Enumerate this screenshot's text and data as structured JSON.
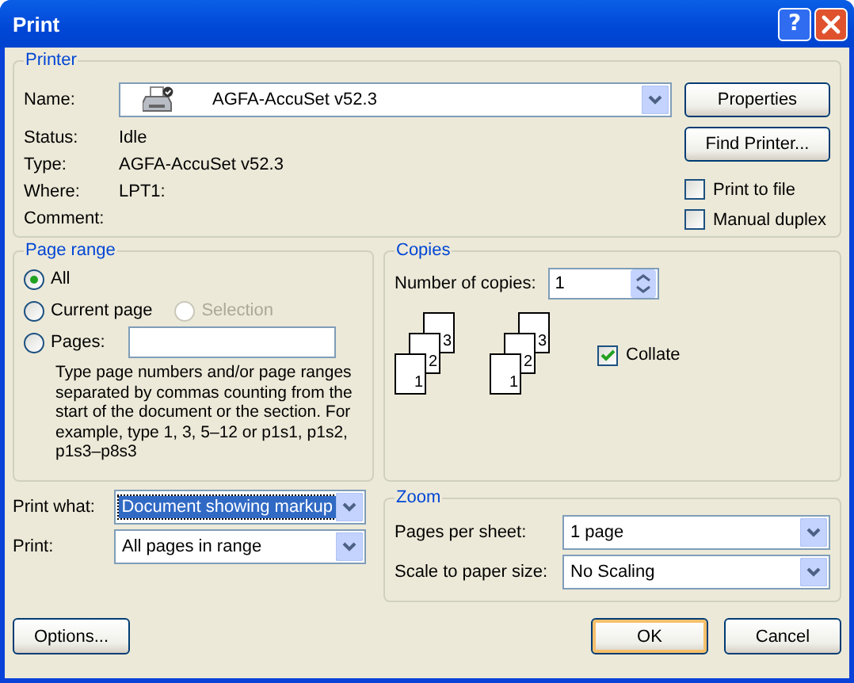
{
  "window": {
    "title": "Print",
    "help_button": "?"
  },
  "printer": {
    "legend": "Printer",
    "name_label": "Name:",
    "name": "AGFA-AccuSet v52.3",
    "info": [
      {
        "label": "Status:",
        "value": "Idle"
      },
      {
        "label": "Type:",
        "value": "AGFA-AccuSet v52.3"
      },
      {
        "label": "Where:",
        "value": "LPT1:"
      },
      {
        "label": "Comment:"
      }
    ],
    "buttons": [
      "Properties",
      "Find Printer..."
    ],
    "options": [
      {
        "label": "Print to file",
        "checked": false
      },
      {
        "label": "Manual duplex",
        "checked": false
      }
    ]
  },
  "page_range": {
    "legend": "Page range",
    "options": [
      {
        "label": "All",
        "selected": true,
        "disabled": false
      },
      {
        "label": "Current page",
        "selected": false,
        "disabled": false
      },
      {
        "label": "Selection",
        "selected": false,
        "disabled": true
      },
      {
        "label": "Pages:",
        "selected": false,
        "disabled": false
      }
    ],
    "help": "Type page numbers and/or page ranges separated by commas counting from the start of the document or the section. For example, type 1, 3, 5–12 or p1s1, p1s2, p1s3–p8s3"
  },
  "copies": {
    "legend": "Copies",
    "count_label": "Number of copies:",
    "count": "1",
    "stacks": [
      {
        "pages": [
          "3",
          "2",
          "1"
        ]
      },
      {
        "pages": [
          "3",
          "2",
          "1"
        ]
      }
    ],
    "collate": {
      "label": "Collate",
      "checked": true
    }
  },
  "print_settings": [
    {
      "label": "Print what:",
      "value": "Document showing markup",
      "highlighted": true
    },
    {
      "label": "Print:",
      "value": "All pages in range",
      "highlighted": false
    }
  ],
  "zoom": {
    "legend": "Zoom",
    "rows": [
      {
        "label": "Pages per sheet:",
        "value": "1 page"
      },
      {
        "label": "Scale to paper size:",
        "value": "No Scaling"
      }
    ]
  },
  "footer": {
    "options_button": "Options...",
    "buttons": [
      {
        "label": "OK",
        "default": true
      },
      {
        "label": "Cancel",
        "default": false
      }
    ]
  }
}
